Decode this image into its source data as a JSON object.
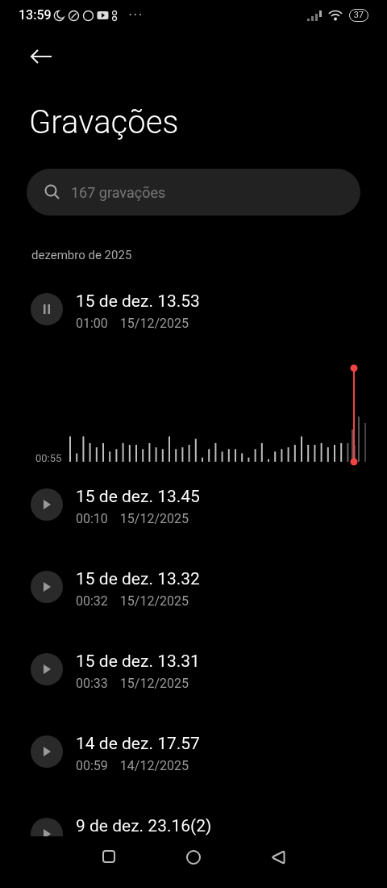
{
  "status_bar": {
    "time": "13:59",
    "more": "···",
    "battery": "37"
  },
  "title": "Gravações",
  "search": {
    "placeholder": "167 gravações"
  },
  "section": "dezembro de 2025",
  "recordings": [
    {
      "title": "15 de dez. 13.53",
      "duration": "01:00",
      "date": "15/12/2025",
      "playing": true,
      "position": "00:55"
    },
    {
      "title": "15 de dez. 13.45",
      "duration": "00:10",
      "date": "15/12/2025",
      "playing": false
    },
    {
      "title": "15 de dez. 13.32",
      "duration": "00:32",
      "date": "15/12/2025",
      "playing": false
    },
    {
      "title": "15 de dez. 13.31",
      "duration": "00:33",
      "date": "15/12/2025",
      "playing": false
    },
    {
      "title": "14 de dez. 17.57",
      "duration": "00:59",
      "date": "14/12/2025",
      "playing": false
    },
    {
      "title": "9 de dez. 23.16(2)",
      "playing": false
    }
  ]
}
